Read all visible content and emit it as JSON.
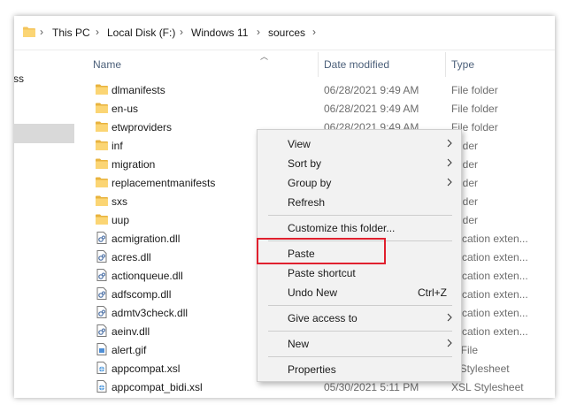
{
  "breadcrumb": [
    "This PC",
    "Local Disk (F:)",
    "Windows 11",
    "sources"
  ],
  "nav": {
    "partial_label": "ss"
  },
  "columns": {
    "name": "Name",
    "date": "Date modified",
    "type": "Type"
  },
  "files": [
    {
      "name": "dlmanifests",
      "date": "06/28/2021 9:49 AM",
      "type": "File folder",
      "icon": "folder-icon"
    },
    {
      "name": "en-us",
      "date": "06/28/2021 9:49 AM",
      "type": "File folder",
      "icon": "folder-icon"
    },
    {
      "name": "etwproviders",
      "date": "06/28/2021 9:49 AM",
      "type": "File folder",
      "icon": "folder-icon"
    },
    {
      "name": "inf",
      "date": "",
      "type": "folder",
      "icon": "folder-icon"
    },
    {
      "name": "migration",
      "date": "",
      "type": "folder",
      "icon": "folder-icon"
    },
    {
      "name": "replacementmanifests",
      "date": "",
      "type": "folder",
      "icon": "folder-icon"
    },
    {
      "name": "sxs",
      "date": "",
      "type": "folder",
      "icon": "folder-icon"
    },
    {
      "name": "uup",
      "date": "",
      "type": "folder",
      "icon": "folder-icon"
    },
    {
      "name": "acmigration.dll",
      "date": "",
      "type": "plication exten...",
      "icon": "dll-icon"
    },
    {
      "name": "acres.dll",
      "date": "",
      "type": "plication exten...",
      "icon": "dll-icon"
    },
    {
      "name": "actionqueue.dll",
      "date": "",
      "type": "plication exten...",
      "icon": "dll-icon"
    },
    {
      "name": "adfscomp.dll",
      "date": "",
      "type": "plication exten...",
      "icon": "dll-icon"
    },
    {
      "name": "admtv3check.dll",
      "date": "",
      "type": "plication exten...",
      "icon": "dll-icon"
    },
    {
      "name": "aeinv.dll",
      "date": "",
      "type": "plication exten...",
      "icon": "dll-icon"
    },
    {
      "name": "alert.gif",
      "date": "",
      "type": "F File",
      "icon": "image-icon"
    },
    {
      "name": "appcompat.xsl",
      "date": "",
      "type": "L Stylesheet",
      "icon": "xsl-icon"
    },
    {
      "name": "appcompat_bidi.xsl",
      "date": "05/30/2021 5:11 PM",
      "type": "XSL Stylesheet",
      "icon": "xsl-icon"
    }
  ],
  "context_menu": {
    "items": [
      {
        "label": "View",
        "submenu": true
      },
      {
        "label": "Sort by",
        "submenu": true
      },
      {
        "label": "Group by",
        "submenu": true
      },
      {
        "label": "Refresh"
      },
      {
        "label": "Customize this folder..."
      },
      {
        "label": "Paste",
        "highlighted": true
      },
      {
        "label": "Paste shortcut"
      },
      {
        "label": "Undo New",
        "shortcut": "Ctrl+Z"
      },
      {
        "label": "Give access to",
        "submenu": true
      },
      {
        "label": "New",
        "submenu": true
      },
      {
        "label": "Properties"
      }
    ]
  },
  "colors": {
    "folder": "#f4c45a",
    "highlight": "#e0202e",
    "header": "#4c607a"
  }
}
